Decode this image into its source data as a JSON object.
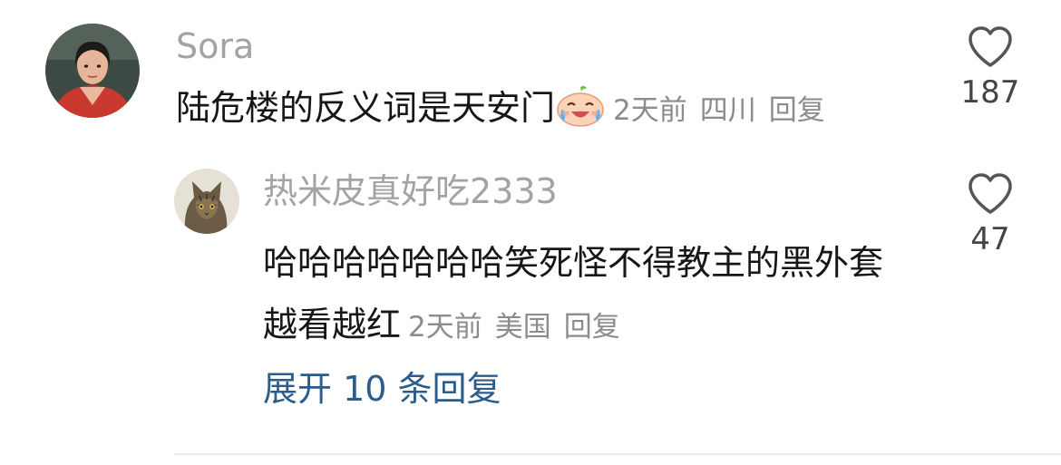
{
  "main_comment": {
    "username": "Sora",
    "text": "陆危楼的反义词是天安门",
    "emoji": "crying-laughing-sticker",
    "time": "2天前",
    "location": "四川",
    "reply_label": "回复",
    "like_count": "187"
  },
  "reply": {
    "username": "热米皮真好吃2333",
    "text": "哈哈哈哈哈哈哈笑死怪不得教主的黑外套越看越红",
    "time": "2天前",
    "location": "美国",
    "reply_label": "回复",
    "like_count": "47"
  },
  "expand_replies": "展开 10 条回复",
  "colors": {
    "username": "#a3a3a3",
    "meta": "#8c8c8c",
    "link": "#2b5d8c",
    "divider": "#ededed"
  }
}
